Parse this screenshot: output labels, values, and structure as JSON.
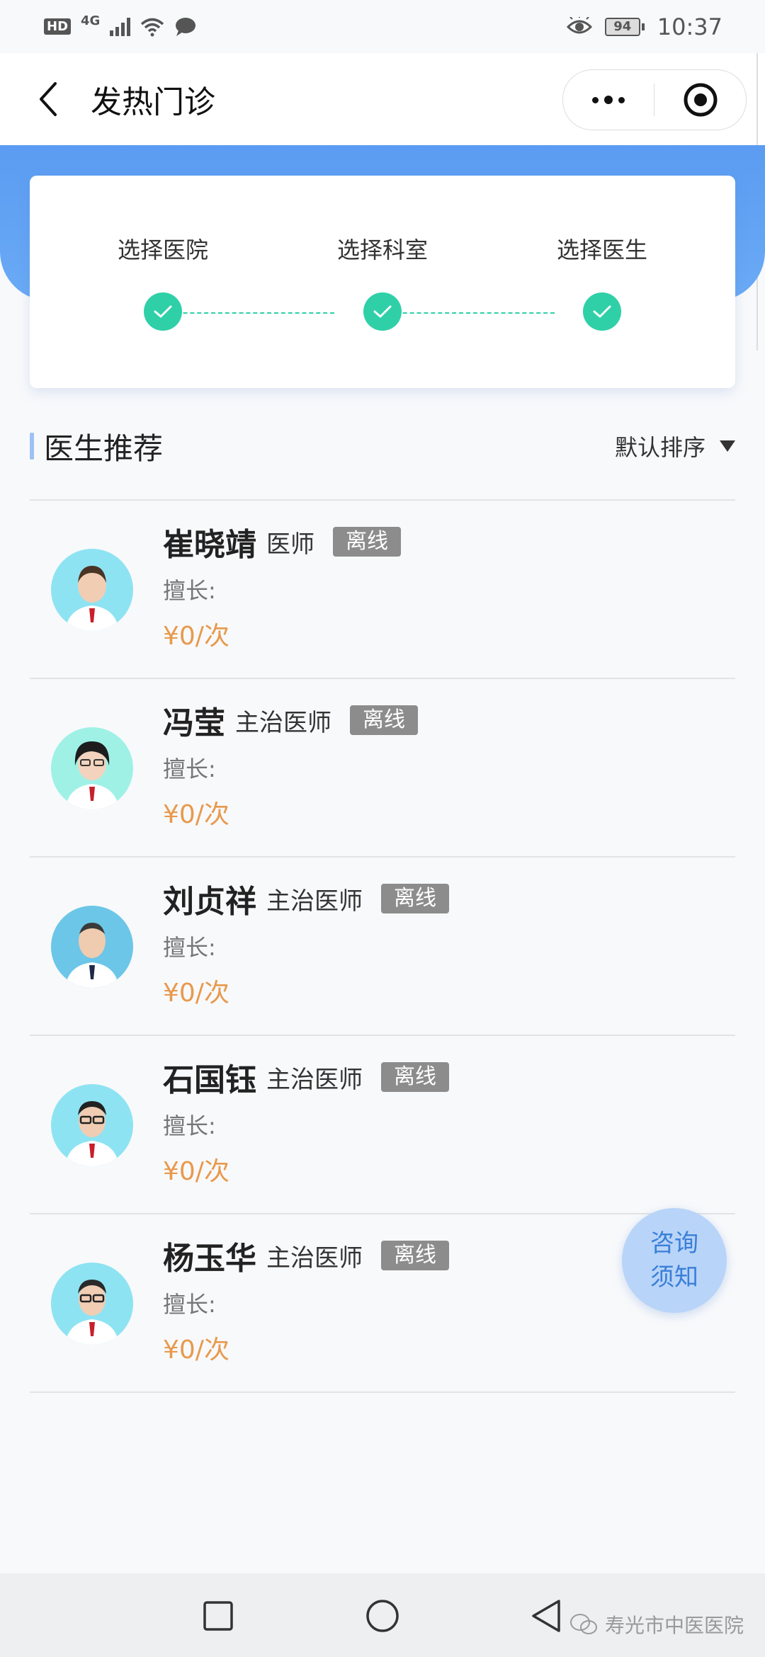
{
  "status_bar": {
    "hd": "HD",
    "network": "4G",
    "battery": "94",
    "time": "10:37"
  },
  "nav": {
    "title": "发热门诊"
  },
  "steps": [
    {
      "label": "选择医院",
      "done": true
    },
    {
      "label": "选择科室",
      "done": true
    },
    {
      "label": "选择医生",
      "done": true
    }
  ],
  "section": {
    "title": "医生推荐",
    "sort_label": "默认排序"
  },
  "doctors": [
    {
      "name": "崔晓靖",
      "title": "医师",
      "status": "离线",
      "specialty": "擅长:",
      "price": "¥0/次"
    },
    {
      "name": "冯莹",
      "title": "主治医师",
      "status": "离线",
      "specialty": "擅长:",
      "price": "¥0/次"
    },
    {
      "name": "刘贞祥",
      "title": "主治医师",
      "status": "离线",
      "specialty": "擅长:",
      "price": "¥0/次"
    },
    {
      "name": "石国钰",
      "title": "主治医师",
      "status": "离线",
      "specialty": "擅长:",
      "price": "¥0/次"
    },
    {
      "name": "杨玉华",
      "title": "主治医师",
      "status": "离线",
      "specialty": "擅长:",
      "price": "¥0/次"
    }
  ],
  "consult_button": {
    "line1": "咨询",
    "line2": "须知"
  },
  "watermark": "寿光市中医医院",
  "colors": {
    "accent_blue": "#5b9cf2",
    "check_green": "#2fd0a8",
    "price_orange": "#e8994c",
    "status_gray": "#8c8c8c"
  },
  "icons": [
    "back-icon",
    "more-icon",
    "close-target-icon",
    "check-icon",
    "sort-triangle-icon",
    "home-square-icon",
    "home-circle-icon",
    "back-triangle-icon",
    "wechat-icon"
  ]
}
